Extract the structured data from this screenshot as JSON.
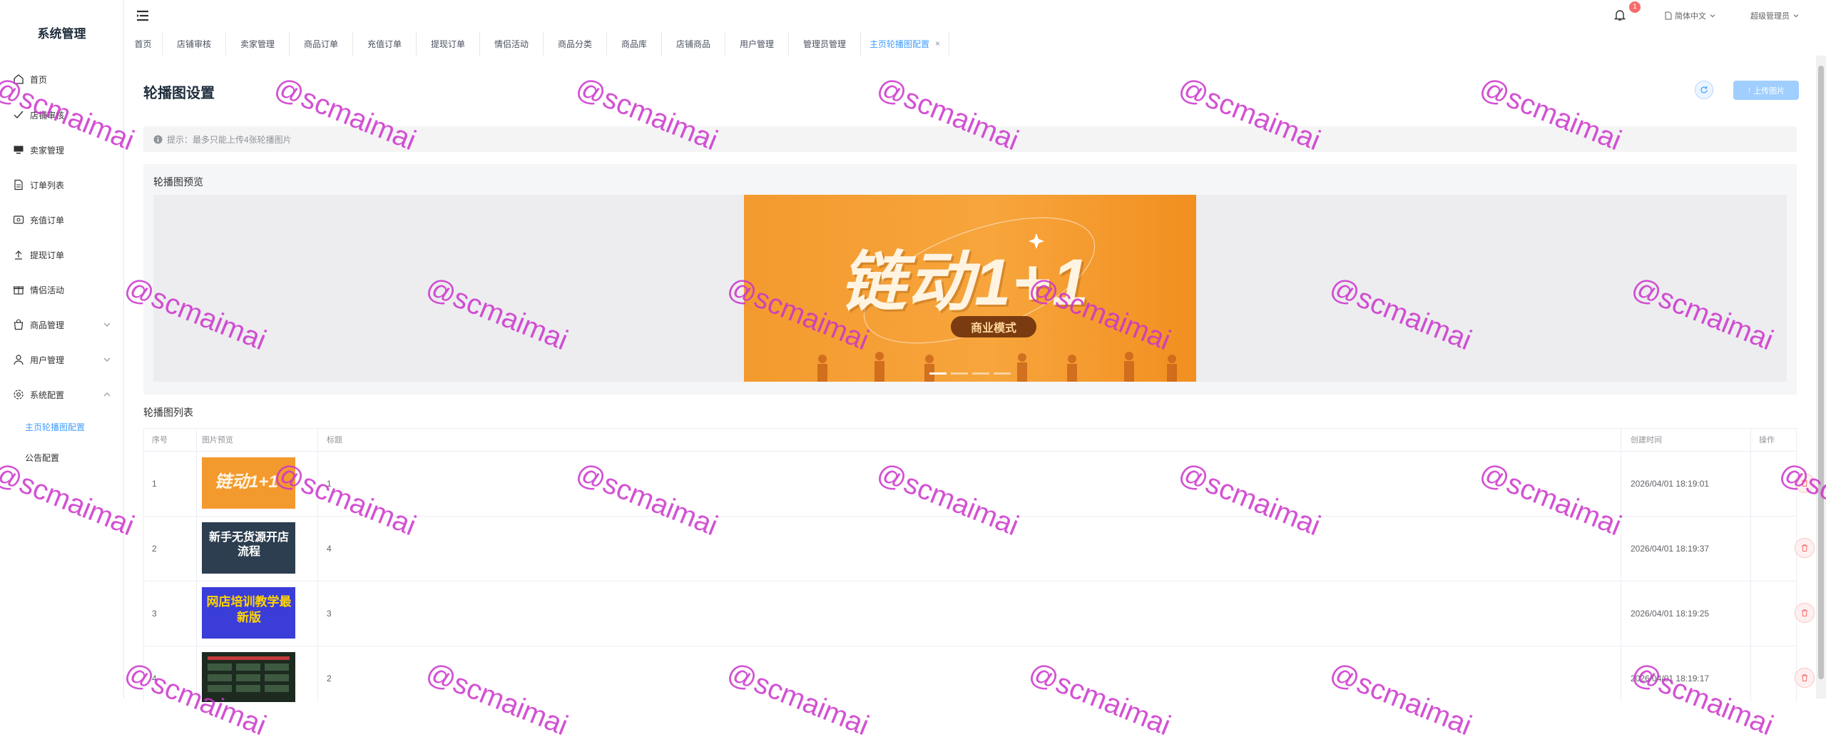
{
  "app": {
    "title": "系统管理"
  },
  "sidebar": {
    "items": [
      {
        "label": "首页",
        "icon": "home-icon"
      },
      {
        "label": "店铺审核",
        "icon": "check-icon"
      },
      {
        "label": "卖家管理",
        "icon": "monitor-icon"
      },
      {
        "label": "订单列表",
        "icon": "document-icon"
      },
      {
        "label": "充值订单",
        "icon": "wallet-icon"
      },
      {
        "label": "提现订单",
        "icon": "upload-icon"
      },
      {
        "label": "情侣活动",
        "icon": "gift-icon"
      },
      {
        "label": "商品管理",
        "icon": "bag-icon"
      },
      {
        "label": "用户管理",
        "icon": "user-icon"
      },
      {
        "label": "系统配置",
        "icon": "gear-icon"
      }
    ],
    "sub_items": [
      {
        "label": "主页轮播图配置"
      },
      {
        "label": "公告配置"
      }
    ]
  },
  "header": {
    "notification_count": "1",
    "language": "简体中文",
    "user": "超级管理员"
  },
  "tabs": [
    "首页",
    "店铺审核",
    "卖家管理",
    "商品订单",
    "充值订单",
    "提现订单",
    "情侣活动",
    "商品分类",
    "商品库",
    "店铺商品",
    "用户管理",
    "管理员管理",
    "主页轮播图配置"
  ],
  "page": {
    "title": "轮播图设置",
    "upload_label": "上传图片",
    "tip": "提示：最多只能上传4张轮播图片",
    "preview_label": "轮播图预览",
    "list_title": "轮播图列表"
  },
  "banner": {
    "headline": "链动1+1",
    "tag": "商业模式"
  },
  "table": {
    "columns": [
      "序号",
      "图片预览",
      "标题",
      "创建时间",
      "操作"
    ],
    "rows": [
      {
        "index": "1",
        "title": "1",
        "created": "2026/04/01 18:19:01",
        "thumb_text": "链动1+1",
        "thumb_color": "#f39a2e"
      },
      {
        "index": "2",
        "title": "4",
        "created": "2026/04/01 18:19:37",
        "thumb_text": "新手无货源开店流程",
        "thumb_color": "#2c3e50"
      },
      {
        "index": "3",
        "title": "3",
        "created": "2026/04/01 18:19:25",
        "thumb_text": "网店培训教学最新版",
        "thumb_color": "#3a3dd8"
      },
      {
        "index": "4",
        "title": "2",
        "created": "2026/04/01 18:19:17",
        "thumb_text": "",
        "thumb_color": "#1c2a1f"
      }
    ]
  },
  "watermark": "@scmaimai",
  "colors": {
    "accent": "#409eff",
    "danger": "#f56c6c",
    "banner": "#f39a2e"
  }
}
